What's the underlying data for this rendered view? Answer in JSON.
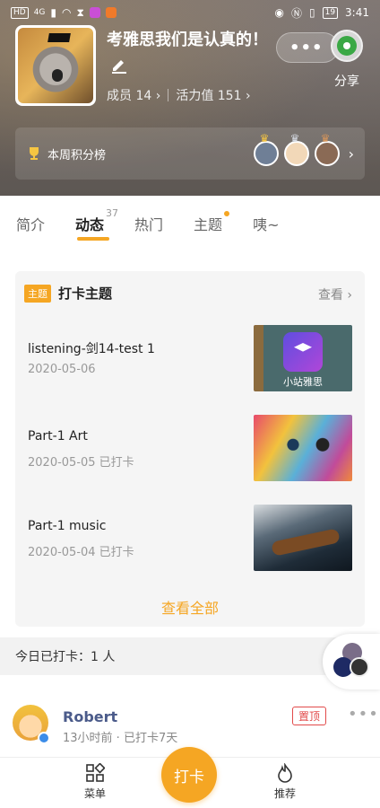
{
  "status_bar": {
    "network": "HD",
    "signal": "4G",
    "battery": "19",
    "time": "3:41"
  },
  "group": {
    "title": "考雅思我们是认真的！",
    "members_label": "成员 14 ›",
    "activity_label": "活力值 151 ›"
  },
  "share_label": "分享",
  "weekly_rank": {
    "label": "本周积分榜"
  },
  "tabs": [
    {
      "label": "简介"
    },
    {
      "label": "动态",
      "badge": "37"
    },
    {
      "label": "热门"
    },
    {
      "label": "主题"
    },
    {
      "label": "咦~"
    }
  ],
  "theme_card": {
    "tag": "主题",
    "title": "打卡主题",
    "view_label": "查看 ›",
    "items": [
      {
        "title": "listening-剑14-test 1",
        "meta": "2020-05-06",
        "thumb_caption": "小站雅思"
      },
      {
        "title": "Part-1 Art",
        "meta": "2020-05-05   已打卡"
      },
      {
        "title": "Part-1 music",
        "meta": "2020-05-04   已打卡"
      }
    ],
    "view_all": "查看全部"
  },
  "today_checkin": "今日已打卡：1 人",
  "post": {
    "author": "Robert",
    "meta": "13小时前 · 已打卡7天",
    "pin_label": "置顶",
    "more": "•••"
  },
  "bottom_nav": {
    "menu": "菜单",
    "checkin": "打卡",
    "recommend": "推荐"
  },
  "colors": {
    "accent": "#f5a623",
    "pin": "#e24a4a",
    "author": "#4b5b8a"
  }
}
